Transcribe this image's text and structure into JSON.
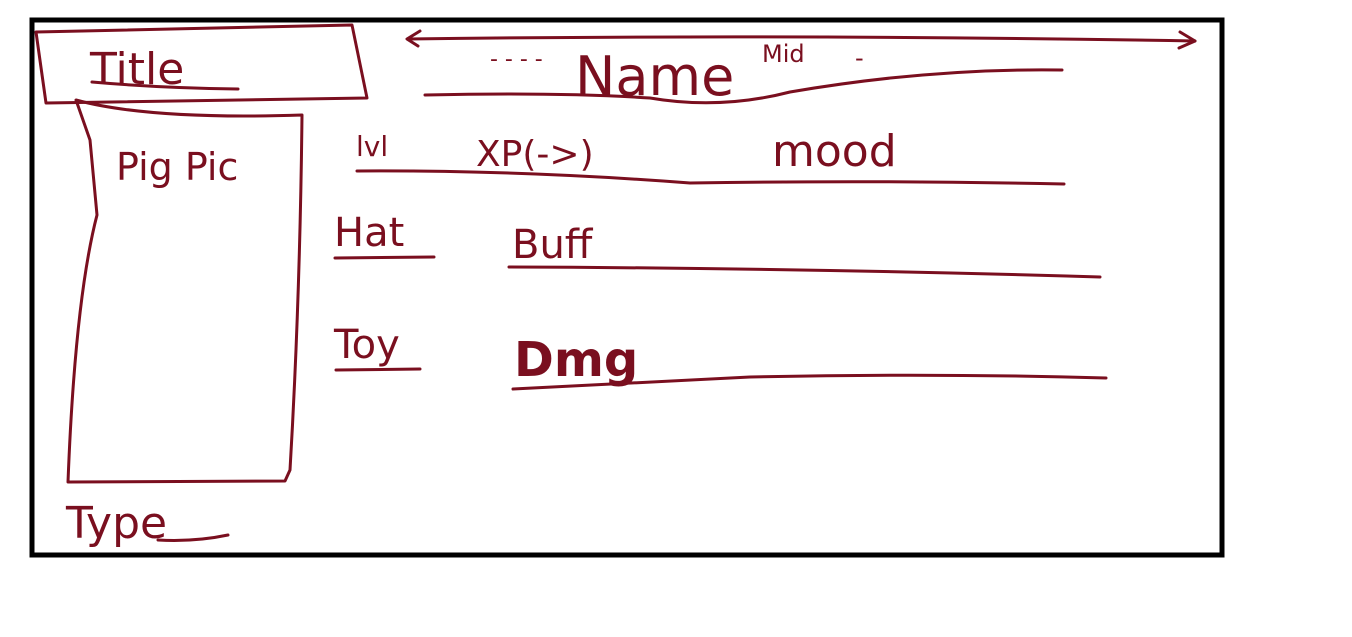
{
  "colors": {
    "ink": "#7a0f1f",
    "frame": "#000000",
    "background": "#ffffff"
  },
  "card": {
    "title": "Title",
    "name": "Name",
    "name_prefix": "- - - -",
    "name_suffix": "-",
    "name_note": "Mid",
    "picture_label": "Pig Pic",
    "type_label": "Type",
    "stats": {
      "level": "lvl",
      "xp": "XP(->)",
      "mood": "mood"
    },
    "rows": [
      {
        "label": "Hat",
        "value": "Buff"
      },
      {
        "label": "Toy",
        "value": "Dmg"
      }
    ]
  }
}
